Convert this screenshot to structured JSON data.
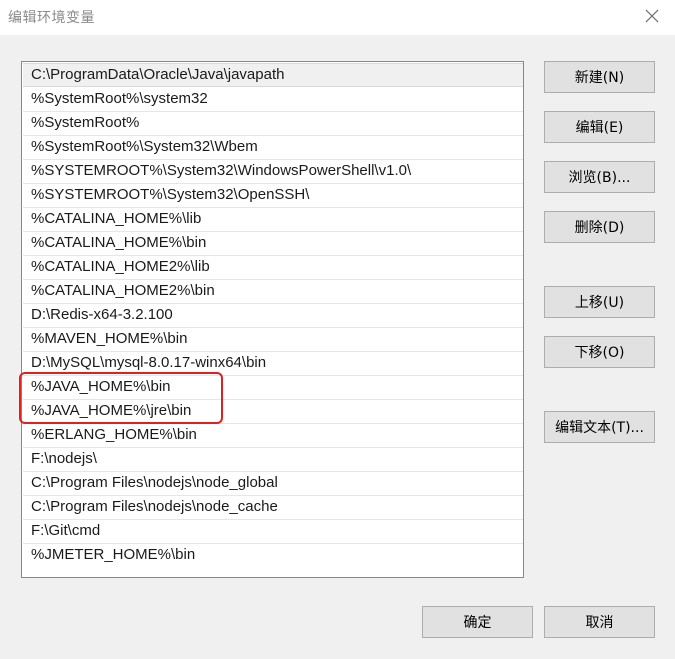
{
  "window": {
    "title": "编辑环境变量"
  },
  "paths": {
    "items": [
      "C:\\ProgramData\\Oracle\\Java\\javapath",
      "%SystemRoot%\\system32",
      "%SystemRoot%",
      "%SystemRoot%\\System32\\Wbem",
      "%SYSTEMROOT%\\System32\\WindowsPowerShell\\v1.0\\",
      "%SYSTEMROOT%\\System32\\OpenSSH\\",
      "%CATALINA_HOME%\\lib",
      "%CATALINA_HOME%\\bin",
      "%CATALINA_HOME2%\\lib",
      "%CATALINA_HOME2%\\bin",
      "D:\\Redis-x64-3.2.100",
      "%MAVEN_HOME%\\bin",
      "D:\\MySQL\\mysql-8.0.17-winx64\\bin",
      "%JAVA_HOME%\\bin",
      "%JAVA_HOME%\\jre\\bin",
      "%ERLANG_HOME%\\bin",
      "F:\\nodejs\\",
      "C:\\Program Files\\nodejs\\node_global",
      "C:\\Program Files\\nodejs\\node_cache",
      "F:\\Git\\cmd",
      "%JMETER_HOME%\\bin"
    ],
    "selected_index": 0,
    "highlighted": [
      "%JAVA_HOME%\\bin",
      "%JAVA_HOME%\\jre\\bin"
    ],
    "highlight_color": "#e02020"
  },
  "buttons": {
    "new": "新建(N)",
    "edit": "编辑(E)",
    "browse": "浏览(B)...",
    "delete": "删除(D)",
    "move_up": "上移(U)",
    "move_down": "下移(O)",
    "edit_text": "编辑文本(T)...",
    "ok": "确定",
    "cancel": "取消"
  }
}
